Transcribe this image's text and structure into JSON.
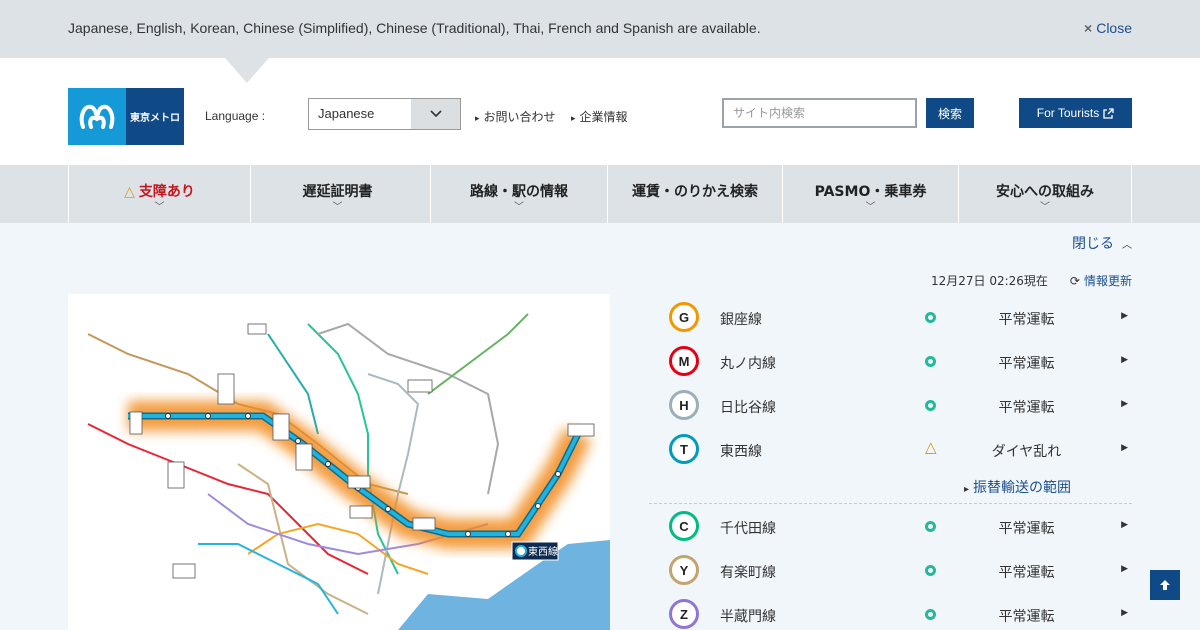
{
  "banner": {
    "message": "Japanese, English, Korean, Chinese (Simplified), Chinese (Traditional), Thai, French and Spanish are available.",
    "close_icon": "×",
    "close_label": "Close"
  },
  "header": {
    "logo_text": "東京メトロ",
    "language_label": "Language :",
    "language_value": "Japanese",
    "links": [
      "お問い合わせ",
      "企業情報"
    ],
    "search_placeholder": "サイト内検索",
    "search_button": "検索",
    "tourists_label": "For Tourists"
  },
  "nav": [
    {
      "label": "支障あり",
      "alert": true
    },
    {
      "label": "遅延証明書"
    },
    {
      "label": "路線・駅の情報"
    },
    {
      "label": "運賃・のりかえ検索"
    },
    {
      "label": "PASMO・乗車券"
    },
    {
      "label": "安心への取組み"
    }
  ],
  "panel": {
    "close_label": "閉じる",
    "updated": "12月27日 02:26現在",
    "refresh_label": "情報更新",
    "map_line_label": "東西線"
  },
  "lines": [
    {
      "letter": "G",
      "name": "銀座線",
      "status": "平常運転",
      "state": "normal",
      "color": "#f39700"
    },
    {
      "letter": "M",
      "name": "丸ノ内線",
      "status": "平常運転",
      "state": "normal",
      "color": "#e60012"
    },
    {
      "letter": "H",
      "name": "日比谷線",
      "status": "平常運転",
      "state": "normal",
      "color": "#9caeb7"
    },
    {
      "letter": "T",
      "name": "東西線",
      "status": "ダイヤ乱れ",
      "state": "warning",
      "color": "#009bbf"
    },
    {
      "letter": "C",
      "name": "千代田線",
      "status": "平常運転",
      "state": "normal",
      "color": "#00bb85"
    },
    {
      "letter": "Y",
      "name": "有楽町線",
      "status": "平常運転",
      "state": "normal",
      "color": "#c1a470"
    },
    {
      "letter": "Z",
      "name": "半蔵門線",
      "status": "平常運転",
      "state": "normal",
      "color": "#8f76d6"
    }
  ],
  "transfer_link": "振替輸送の範囲"
}
